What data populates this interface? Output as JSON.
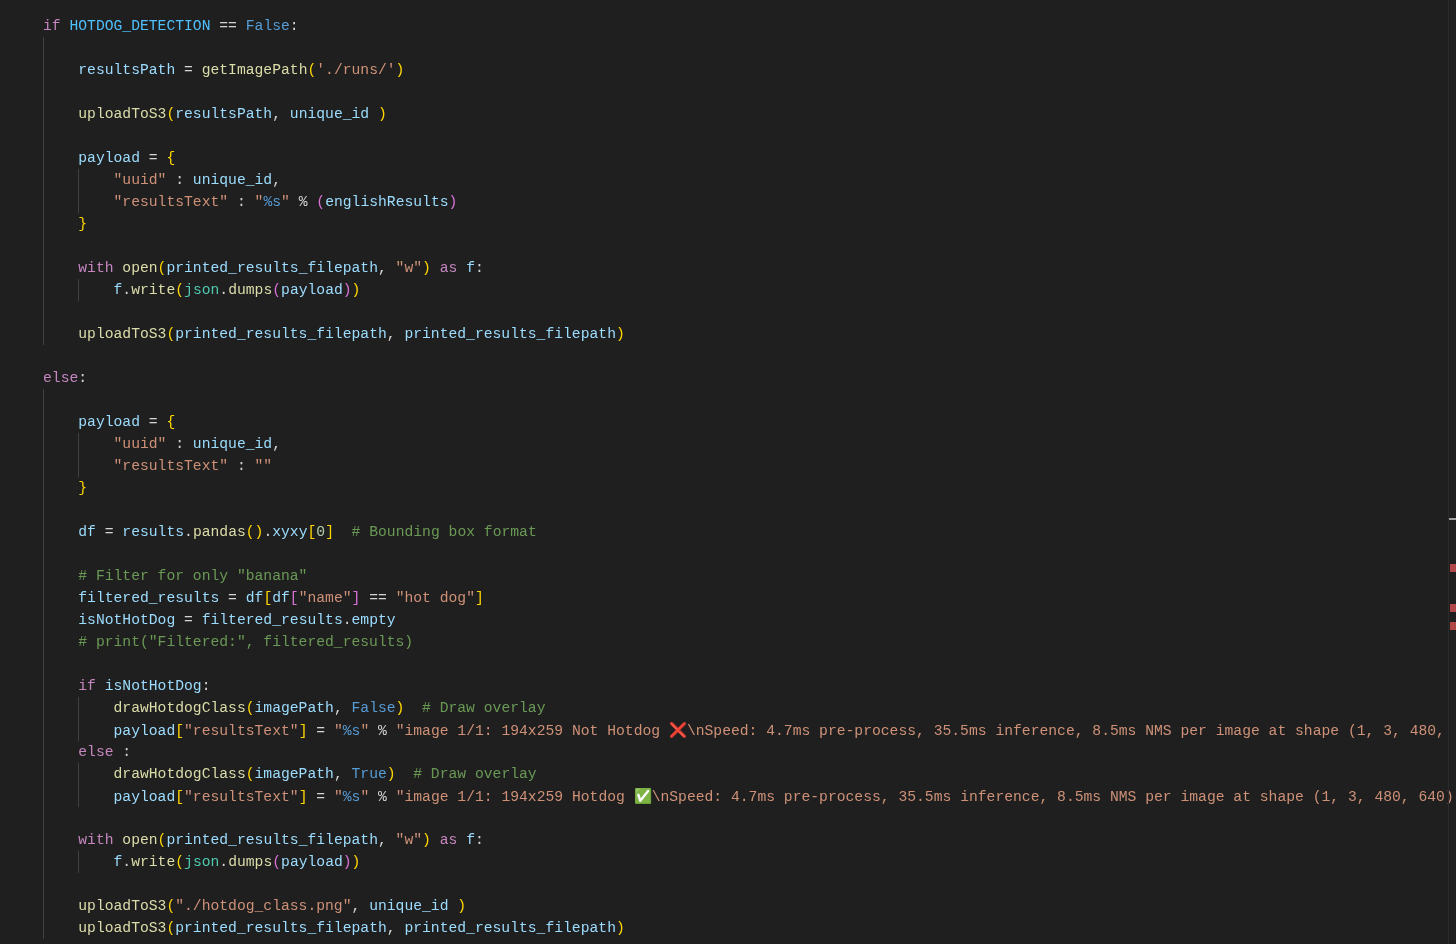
{
  "editor": {
    "lines": [
      {
        "kind": "line",
        "tokens": [
          {
            "kind": "kw",
            "text": "if "
          },
          {
            "kind": "cvar",
            "text": "HOTDOG_DETECTION"
          },
          {
            "kind": "op",
            "text": " == "
          },
          {
            "kind": "const",
            "text": "False"
          },
          {
            "kind": "op",
            "text": ":"
          }
        ]
      },
      {
        "kind": "block",
        "children": [
          {
            "kind": "blank"
          },
          {
            "kind": "line",
            "tokens": [
              {
                "kind": "var",
                "text": "resultsPath"
              },
              {
                "kind": "op",
                "text": " = "
              },
              {
                "kind": "fn",
                "text": "getImagePath"
              },
              {
                "kind": "b1",
                "text": "("
              },
              {
                "kind": "str",
                "text": "'./runs/'"
              },
              {
                "kind": "b1",
                "text": ")"
              }
            ]
          },
          {
            "kind": "blank"
          },
          {
            "kind": "line",
            "tokens": [
              {
                "kind": "fn",
                "text": "uploadToS3"
              },
              {
                "kind": "b1",
                "text": "("
              },
              {
                "kind": "var",
                "text": "resultsPath"
              },
              {
                "kind": "op",
                "text": ", "
              },
              {
                "kind": "var",
                "text": "unique_id "
              },
              {
                "kind": "b1",
                "text": ")"
              }
            ]
          },
          {
            "kind": "blank"
          },
          {
            "kind": "line",
            "tokens": [
              {
                "kind": "var",
                "text": "payload"
              },
              {
                "kind": "op",
                "text": " = "
              },
              {
                "kind": "b1",
                "text": "{"
              }
            ]
          },
          {
            "kind": "block",
            "children": [
              {
                "kind": "line",
                "tokens": [
                  {
                    "kind": "str",
                    "text": "\"uuid\""
                  },
                  {
                    "kind": "op",
                    "text": " : "
                  },
                  {
                    "kind": "var",
                    "text": "unique_id"
                  },
                  {
                    "kind": "op",
                    "text": ","
                  }
                ]
              },
              {
                "kind": "line",
                "tokens": [
                  {
                    "kind": "str",
                    "text": "\"resultsText\""
                  },
                  {
                    "kind": "op",
                    "text": " : "
                  },
                  {
                    "kind": "str",
                    "text": "\""
                  },
                  {
                    "kind": "fmt",
                    "text": "%s"
                  },
                  {
                    "kind": "str",
                    "text": "\""
                  },
                  {
                    "kind": "op",
                    "text": " % "
                  },
                  {
                    "kind": "b2",
                    "text": "("
                  },
                  {
                    "kind": "var",
                    "text": "englishResults"
                  },
                  {
                    "kind": "b2",
                    "text": ")"
                  }
                ]
              }
            ]
          },
          {
            "kind": "line",
            "tokens": [
              {
                "kind": "b1",
                "text": "}"
              }
            ]
          },
          {
            "kind": "blank"
          },
          {
            "kind": "line",
            "tokens": [
              {
                "kind": "kw",
                "text": "with "
              },
              {
                "kind": "fn",
                "text": "open"
              },
              {
                "kind": "b1",
                "text": "("
              },
              {
                "kind": "var",
                "text": "printed_results_filepath"
              },
              {
                "kind": "op",
                "text": ", "
              },
              {
                "kind": "str",
                "text": "\"w\""
              },
              {
                "kind": "b1",
                "text": ")"
              },
              {
                "kind": "kw",
                "text": " as "
              },
              {
                "kind": "var",
                "text": "f"
              },
              {
                "kind": "op",
                "text": ":"
              }
            ]
          },
          {
            "kind": "block",
            "children": [
              {
                "kind": "line",
                "tokens": [
                  {
                    "kind": "var",
                    "text": "f"
                  },
                  {
                    "kind": "op",
                    "text": "."
                  },
                  {
                    "kind": "fn",
                    "text": "write"
                  },
                  {
                    "kind": "b1",
                    "text": "("
                  },
                  {
                    "kind": "cls",
                    "text": "json"
                  },
                  {
                    "kind": "op",
                    "text": "."
                  },
                  {
                    "kind": "fn",
                    "text": "dumps"
                  },
                  {
                    "kind": "b2",
                    "text": "("
                  },
                  {
                    "kind": "var",
                    "text": "payload"
                  },
                  {
                    "kind": "b2",
                    "text": ")"
                  },
                  {
                    "kind": "b1",
                    "text": ")"
                  }
                ]
              }
            ]
          },
          {
            "kind": "blank"
          },
          {
            "kind": "line",
            "tokens": [
              {
                "kind": "fn",
                "text": "uploadToS3"
              },
              {
                "kind": "b1",
                "text": "("
              },
              {
                "kind": "var",
                "text": "printed_results_filepath"
              },
              {
                "kind": "op",
                "text": ", "
              },
              {
                "kind": "var",
                "text": "printed_results_filepath"
              },
              {
                "kind": "b1",
                "text": ")"
              }
            ]
          }
        ]
      },
      {
        "kind": "blank"
      },
      {
        "kind": "line",
        "tokens": [
          {
            "kind": "kw",
            "text": "else"
          },
          {
            "kind": "op",
            "text": ":"
          }
        ]
      },
      {
        "kind": "block",
        "children": [
          {
            "kind": "blank"
          },
          {
            "kind": "line",
            "tokens": [
              {
                "kind": "var",
                "text": "payload"
              },
              {
                "kind": "op",
                "text": " = "
              },
              {
                "kind": "b1",
                "text": "{"
              }
            ]
          },
          {
            "kind": "block",
            "children": [
              {
                "kind": "line",
                "tokens": [
                  {
                    "kind": "str",
                    "text": "\"uuid\""
                  },
                  {
                    "kind": "op",
                    "text": " : "
                  },
                  {
                    "kind": "var",
                    "text": "unique_id"
                  },
                  {
                    "kind": "op",
                    "text": ","
                  }
                ]
              },
              {
                "kind": "line",
                "tokens": [
                  {
                    "kind": "str",
                    "text": "\"resultsText\""
                  },
                  {
                    "kind": "op",
                    "text": " : "
                  },
                  {
                    "kind": "str",
                    "text": "\"\""
                  }
                ]
              }
            ]
          },
          {
            "kind": "line",
            "tokens": [
              {
                "kind": "b1",
                "text": "}"
              }
            ]
          },
          {
            "kind": "blank"
          },
          {
            "kind": "line",
            "tokens": [
              {
                "kind": "var",
                "text": "df"
              },
              {
                "kind": "op",
                "text": " = "
              },
              {
                "kind": "var",
                "text": "results"
              },
              {
                "kind": "op",
                "text": "."
              },
              {
                "kind": "fn",
                "text": "pandas"
              },
              {
                "kind": "b1",
                "text": "()"
              },
              {
                "kind": "op",
                "text": "."
              },
              {
                "kind": "var",
                "text": "xyxy"
              },
              {
                "kind": "b1",
                "text": "["
              },
              {
                "kind": "num",
                "text": "0"
              },
              {
                "kind": "b1",
                "text": "]"
              },
              {
                "kind": "cmt",
                "text": "  # Bounding box format"
              }
            ]
          },
          {
            "kind": "blank"
          },
          {
            "kind": "line",
            "tokens": [
              {
                "kind": "cmt",
                "text": "# Filter for only \"banana\""
              }
            ]
          },
          {
            "kind": "line",
            "tokens": [
              {
                "kind": "var",
                "text": "filtered_results"
              },
              {
                "kind": "op",
                "text": " = "
              },
              {
                "kind": "var",
                "text": "df"
              },
              {
                "kind": "b1",
                "text": "["
              },
              {
                "kind": "var",
                "text": "df"
              },
              {
                "kind": "b2",
                "text": "["
              },
              {
                "kind": "str",
                "text": "\"name\""
              },
              {
                "kind": "b2",
                "text": "]"
              },
              {
                "kind": "op",
                "text": " == "
              },
              {
                "kind": "str",
                "text": "\"hot dog\""
              },
              {
                "kind": "b1",
                "text": "]"
              }
            ]
          },
          {
            "kind": "line",
            "tokens": [
              {
                "kind": "var",
                "text": "isNotHotDog"
              },
              {
                "kind": "op",
                "text": " = "
              },
              {
                "kind": "var",
                "text": "filtered_results"
              },
              {
                "kind": "op",
                "text": "."
              },
              {
                "kind": "var",
                "text": "empty"
              }
            ]
          },
          {
            "kind": "line",
            "tokens": [
              {
                "kind": "cmt",
                "text": "# print(\"Filtered:\", filtered_results)"
              }
            ]
          },
          {
            "kind": "blank"
          },
          {
            "kind": "line",
            "tokens": [
              {
                "kind": "kw",
                "text": "if "
              },
              {
                "kind": "var",
                "text": "isNotHotDog"
              },
              {
                "kind": "op",
                "text": ":"
              }
            ]
          },
          {
            "kind": "block",
            "children": [
              {
                "kind": "line",
                "tokens": [
                  {
                    "kind": "fn",
                    "text": "drawHotdogClass"
                  },
                  {
                    "kind": "b1",
                    "text": "("
                  },
                  {
                    "kind": "var",
                    "text": "imagePath"
                  },
                  {
                    "kind": "op",
                    "text": ", "
                  },
                  {
                    "kind": "const",
                    "text": "False"
                  },
                  {
                    "kind": "b1",
                    "text": ")"
                  },
                  {
                    "kind": "cmt",
                    "text": "  # Draw overlay"
                  }
                ]
              },
              {
                "kind": "line",
                "tokens": [
                  {
                    "kind": "var",
                    "text": "payload"
                  },
                  {
                    "kind": "b1",
                    "text": "["
                  },
                  {
                    "kind": "str",
                    "text": "\"resultsText\""
                  },
                  {
                    "kind": "b1",
                    "text": "]"
                  },
                  {
                    "kind": "op",
                    "text": " = "
                  },
                  {
                    "kind": "str",
                    "text": "\""
                  },
                  {
                    "kind": "fmt",
                    "text": "%s"
                  },
                  {
                    "kind": "str",
                    "text": "\""
                  },
                  {
                    "kind": "op",
                    "text": " % "
                  },
                  {
                    "kind": "str",
                    "text": "\"image 1/1: 194x259 Not Hotdog "
                  },
                  {
                    "kind": "cross",
                    "text": "❌"
                  },
                  {
                    "kind": "str",
                    "text": "\\nSpeed: 4.7ms pre-process, 35.5ms inference, 8.5ms NMS per image at shape (1, 3, 480,"
                  }
                ]
              }
            ]
          },
          {
            "kind": "line",
            "tokens": [
              {
                "kind": "kw",
                "text": "else"
              },
              {
                "kind": "op",
                "text": " :"
              }
            ]
          },
          {
            "kind": "block",
            "children": [
              {
                "kind": "line",
                "tokens": [
                  {
                    "kind": "fn",
                    "text": "drawHotdogClass"
                  },
                  {
                    "kind": "b1",
                    "text": "("
                  },
                  {
                    "kind": "var",
                    "text": "imagePath"
                  },
                  {
                    "kind": "op",
                    "text": ", "
                  },
                  {
                    "kind": "const",
                    "text": "True"
                  },
                  {
                    "kind": "b1",
                    "text": ")"
                  },
                  {
                    "kind": "cmt",
                    "text": "  # Draw overlay"
                  }
                ]
              },
              {
                "kind": "line",
                "tokens": [
                  {
                    "kind": "var",
                    "text": "payload"
                  },
                  {
                    "kind": "b1",
                    "text": "["
                  },
                  {
                    "kind": "str",
                    "text": "\"resultsText\""
                  },
                  {
                    "kind": "b1",
                    "text": "]"
                  },
                  {
                    "kind": "op",
                    "text": " = "
                  },
                  {
                    "kind": "str",
                    "text": "\""
                  },
                  {
                    "kind": "fmt",
                    "text": "%s"
                  },
                  {
                    "kind": "str",
                    "text": "\""
                  },
                  {
                    "kind": "op",
                    "text": " % "
                  },
                  {
                    "kind": "str",
                    "text": "\"image 1/1: 194x259 Hotdog "
                  },
                  {
                    "kind": "check",
                    "text": "✅"
                  },
                  {
                    "kind": "str",
                    "text": "\\nSpeed: 4.7ms pre-process, 35.5ms inference, 8.5ms NMS per image at shape (1, 3, 480, 640)"
                  }
                ]
              }
            ]
          },
          {
            "kind": "blank"
          },
          {
            "kind": "line",
            "tokens": [
              {
                "kind": "kw",
                "text": "with "
              },
              {
                "kind": "fn",
                "text": "open"
              },
              {
                "kind": "b1",
                "text": "("
              },
              {
                "kind": "var",
                "text": "printed_results_filepath"
              },
              {
                "kind": "op",
                "text": ", "
              },
              {
                "kind": "str",
                "text": "\"w\""
              },
              {
                "kind": "b1",
                "text": ")"
              },
              {
                "kind": "kw",
                "text": " as "
              },
              {
                "kind": "var",
                "text": "f"
              },
              {
                "kind": "op",
                "text": ":"
              }
            ]
          },
          {
            "kind": "block",
            "children": [
              {
                "kind": "line",
                "tokens": [
                  {
                    "kind": "var",
                    "text": "f"
                  },
                  {
                    "kind": "op",
                    "text": "."
                  },
                  {
                    "kind": "fn",
                    "text": "write"
                  },
                  {
                    "kind": "b1",
                    "text": "("
                  },
                  {
                    "kind": "cls",
                    "text": "json"
                  },
                  {
                    "kind": "op",
                    "text": "."
                  },
                  {
                    "kind": "fn",
                    "text": "dumps"
                  },
                  {
                    "kind": "b2",
                    "text": "("
                  },
                  {
                    "kind": "var",
                    "text": "payload"
                  },
                  {
                    "kind": "b2",
                    "text": ")"
                  },
                  {
                    "kind": "b1",
                    "text": ")"
                  }
                ]
              }
            ]
          },
          {
            "kind": "blank"
          },
          {
            "kind": "line",
            "tokens": [
              {
                "kind": "fn",
                "text": "uploadToS3"
              },
              {
                "kind": "b1",
                "text": "("
              },
              {
                "kind": "str",
                "text": "\"./hotdog_class.png\""
              },
              {
                "kind": "op",
                "text": ", "
              },
              {
                "kind": "var",
                "text": "unique_id "
              },
              {
                "kind": "b1",
                "text": ")"
              }
            ]
          },
          {
            "kind": "line",
            "tokens": [
              {
                "kind": "fn",
                "text": "uploadToS3"
              },
              {
                "kind": "b1",
                "text": "("
              },
              {
                "kind": "var",
                "text": "printed_results_filepath"
              },
              {
                "kind": "op",
                "text": ", "
              },
              {
                "kind": "var",
                "text": "printed_results_filepath"
              },
              {
                "kind": "b1",
                "text": ")"
              }
            ]
          }
        ]
      }
    ]
  }
}
